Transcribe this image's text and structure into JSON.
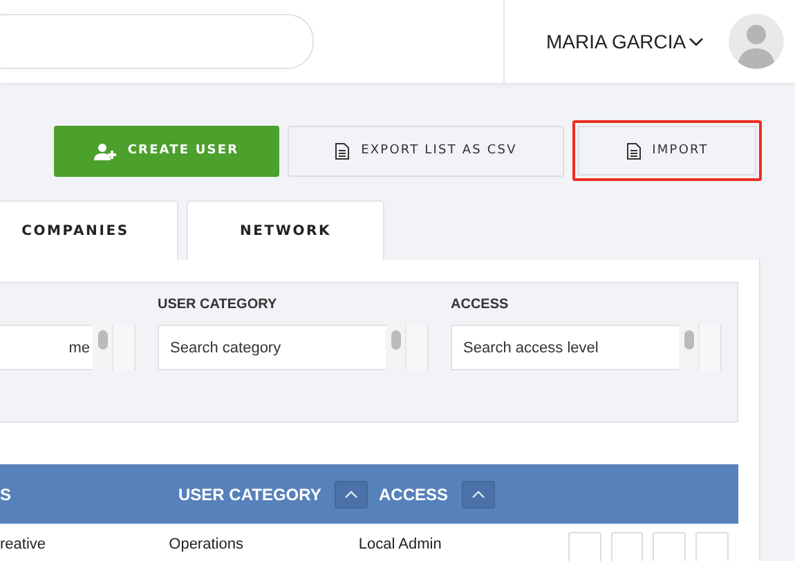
{
  "header": {
    "user_name": "MARIA GARCIA"
  },
  "actions": [
    {
      "label": "CREATE USER",
      "kind": "primary",
      "highlighted": false
    },
    {
      "label": "EXPORT LIST AS CSV",
      "kind": "document",
      "highlighted": false
    },
    {
      "label": "IMPORT",
      "kind": "document",
      "highlighted": true
    }
  ],
  "tabs": [
    {
      "label": "COMPANIES",
      "selected": false
    },
    {
      "label": "NETWORK",
      "selected": false
    }
  ],
  "filters": [
    {
      "placeholder": "me"
    },
    {
      "label": "USER CATEGORY",
      "placeholder": "Search category"
    },
    {
      "label": "ACCESS",
      "placeholder": "Search access level"
    }
  ],
  "table": {
    "columns": [
      {
        "label": "S",
        "sortable": false
      },
      {
        "label": "USER CATEGORY",
        "sortable": true
      },
      {
        "label": "ACCESS",
        "sortable": true
      }
    ],
    "rows": [
      {
        "cells": [
          "reative",
          "Operations",
          "Local Admin"
        ]
      }
    ]
  }
}
